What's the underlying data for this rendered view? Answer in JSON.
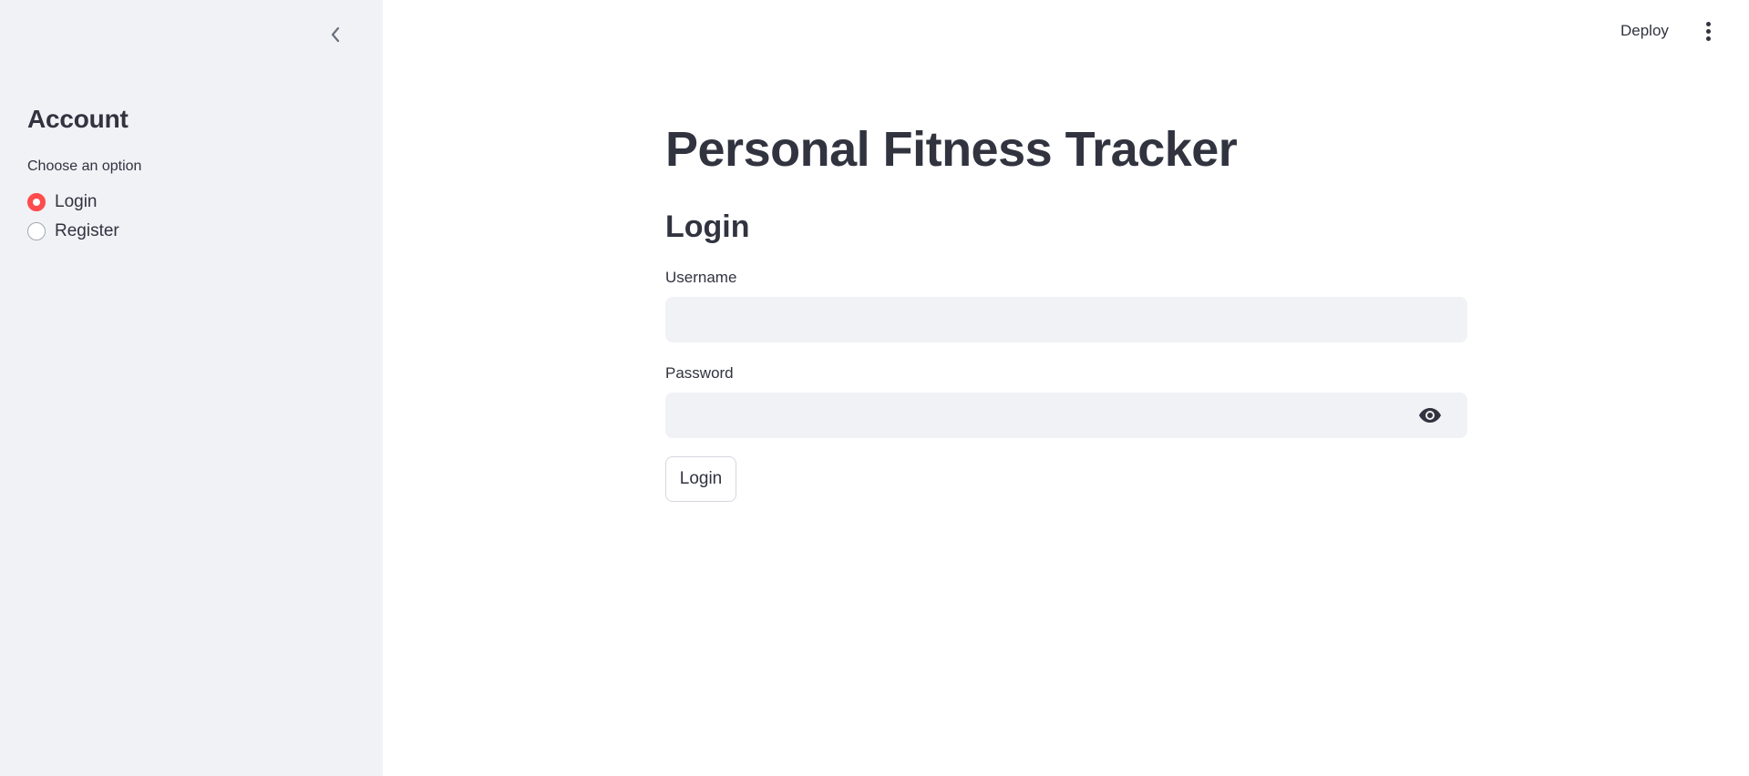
{
  "sidebar": {
    "collapse_icon": "chevron-left-icon",
    "title": "Account",
    "radio_label": "Choose an option",
    "options": [
      {
        "label": "Login",
        "selected": true
      },
      {
        "label": "Register",
        "selected": false
      }
    ],
    "accent_color": "#ff4b4b"
  },
  "header": {
    "deploy_label": "Deploy",
    "menu_icon": "more-vertical-icon"
  },
  "main": {
    "title": "Personal Fitness Tracker",
    "subtitle": "Login",
    "username_label": "Username",
    "username_value": "",
    "password_label": "Password",
    "password_value": "",
    "password_toggle_icon": "eye-icon",
    "submit_label": "Login"
  }
}
